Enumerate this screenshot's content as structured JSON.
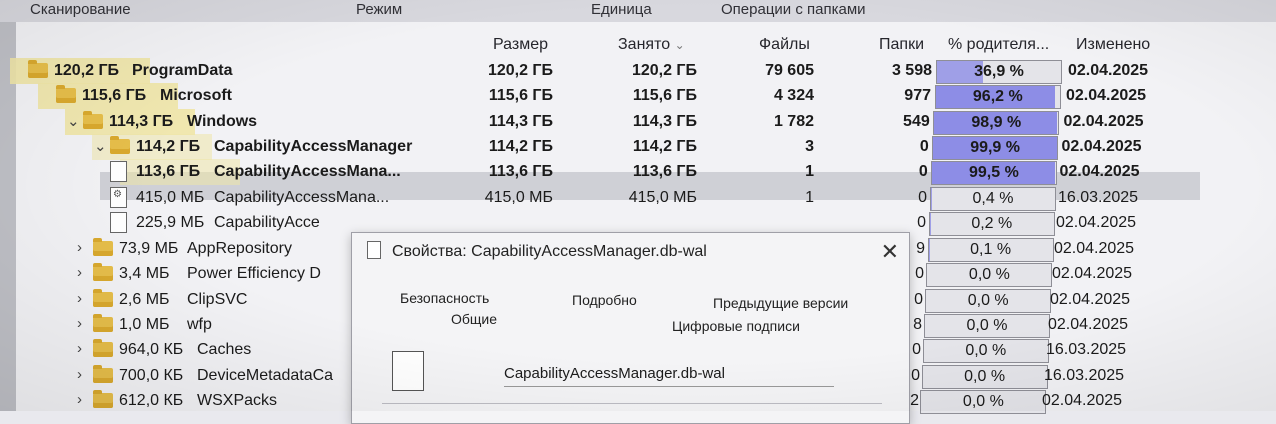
{
  "menu": [
    "Сканирование",
    "Режим",
    "Единица",
    "Операции с папками"
  ],
  "columns": {
    "size": "Размер",
    "occupied": "Занято",
    "files": "Файлы",
    "folders": "Папки",
    "pct": "% родителя...",
    "modified": "Изменено"
  },
  "rows": [
    {
      "icon": "folder",
      "chevron": "",
      "sz": "120,2 ГБ",
      "name": "ProgramData",
      "size": "120,2 ГБ",
      "occupied": "120,2 ГБ",
      "files": "79 605",
      "folders": "3 598",
      "pct": "36,9 %",
      "pct_value": 36.9,
      "date": "02.04.2025",
      "bold": true
    },
    {
      "icon": "folder",
      "chevron": "",
      "sz": "115,6 ГБ",
      "name": "Microsoft",
      "size": "115,6 ГБ",
      "occupied": "115,6 ГБ",
      "files": "4 324",
      "folders": "977",
      "pct": "96,2 %",
      "pct_value": 96.2,
      "date": "02.04.2025",
      "bold": true
    },
    {
      "icon": "folder",
      "chevron": "⌄",
      "sz": "114,3 ГБ",
      "name": "Windows",
      "size": "114,3 ГБ",
      "occupied": "114,3 ГБ",
      "files": "1 782",
      "folders": "549",
      "pct": "98,9 %",
      "pct_value": 98.9,
      "date": "02.04.2025",
      "bold": true
    },
    {
      "icon": "folder",
      "chevron": "⌄",
      "sz": "114,2 ГБ",
      "name": "CapabilityAccessManager",
      "size": "114,2 ГБ",
      "occupied": "114,2 ГБ",
      "files": "3",
      "folders": "0",
      "pct": "99,9 %",
      "pct_value": 99.9,
      "date": "02.04.2025",
      "bold": true
    },
    {
      "icon": "file",
      "chevron": "",
      "sz": "113,6 ГБ",
      "name": "CapabilityAccessMana...",
      "size": "113,6 ГБ",
      "occupied": "113,6 ГБ",
      "files": "1",
      "folders": "0",
      "pct": "99,5 %",
      "pct_value": 99.5,
      "date": "02.04.2025",
      "bold": true,
      "selected": true
    },
    {
      "icon": "file-gear",
      "chevron": "",
      "sz": "415,0 МБ",
      "name": "CapabilityAccessMana...",
      "size": "415,0 МБ",
      "occupied": "415,0 МБ",
      "files": "1",
      "folders": "0",
      "pct": "0,4 %",
      "pct_value": 0.4,
      "date": "16.03.2025",
      "bold": false
    },
    {
      "icon": "file",
      "chevron": "",
      "sz": "225,9 МБ",
      "name": "CapabilityAcce",
      "size": "",
      "occupied": "",
      "files": "",
      "folders": "0",
      "pct": "0,2 %",
      "pct_value": 0.2,
      "date": "02.04.2025",
      "bold": false
    },
    {
      "icon": "folder",
      "chevron": "›",
      "sz": "73,9 МБ",
      "name": "AppRepository",
      "size": "",
      "occupied": "",
      "files": "",
      "folders": "9",
      "pct": "0,1 %",
      "pct_value": 0.1,
      "date": "02.04.2025",
      "bold": false
    },
    {
      "icon": "folder",
      "chevron": "›",
      "sz": "3,4 МБ",
      "name": "Power Efficiency D",
      "size": "",
      "occupied": "",
      "files": "",
      "folders": "0",
      "pct": "0,0 %",
      "pct_value": 0.0,
      "date": "02.04.2025",
      "bold": false
    },
    {
      "icon": "folder",
      "chevron": "›",
      "sz": "2,6 МБ",
      "name": "ClipSVC",
      "size": "",
      "occupied": "",
      "files": "",
      "folders": "0",
      "pct": "0,0 %",
      "pct_value": 0.0,
      "date": "02.04.2025",
      "bold": false
    },
    {
      "icon": "folder",
      "chevron": "›",
      "sz": "1,0 МБ",
      "name": "wfp",
      "size": "",
      "occupied": "",
      "files": "",
      "folders": "8",
      "pct": "0,0 %",
      "pct_value": 0.0,
      "date": "02.04.2025",
      "bold": false
    },
    {
      "icon": "folder",
      "chevron": "›",
      "sz": "964,0 КБ",
      "name": "Caches",
      "size": "",
      "occupied": "",
      "files": "",
      "folders": "0",
      "pct": "0,0 %",
      "pct_value": 0.0,
      "date": "16.03.2025",
      "bold": false
    },
    {
      "icon": "folder",
      "chevron": "›",
      "sz": "700,0 КБ",
      "name": "DeviceMetadataCa",
      "size": "",
      "occupied": "",
      "files": "",
      "folders": "0",
      "pct": "0,0 %",
      "pct_value": 0.0,
      "date": "16.03.2025",
      "bold": false
    },
    {
      "icon": "folder",
      "chevron": "›",
      "sz": "612,0 КБ",
      "name": "WSXPacks",
      "size": "",
      "occupied": "",
      "files": "",
      "folders": "2",
      "pct": "0,0 %",
      "pct_value": 0.0,
      "date": "02.04.2025",
      "bold": false
    }
  ],
  "dialog": {
    "title": "Свойства: CapabilityAccessManager.db-wal",
    "tabs": [
      "Безопасность",
      "Подробно",
      "Предыдущие версии",
      "Общие",
      "Цифровые подписи"
    ],
    "filename": "CapabilityAccessManager.db-wal"
  },
  "colors": {
    "bar_fill": "#8d8de6",
    "size_band": "#efe5a7"
  }
}
